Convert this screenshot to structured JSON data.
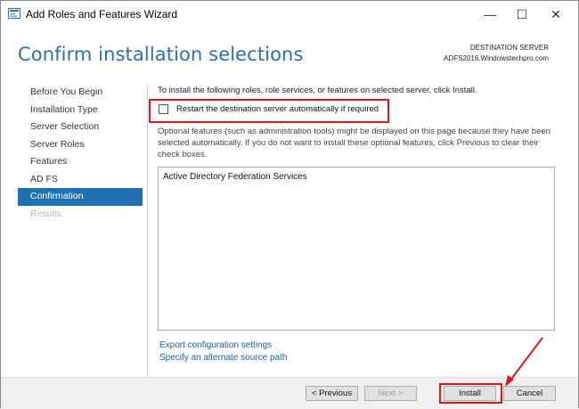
{
  "window": {
    "title": "Add Roles and Features Wizard",
    "minimize_glyph": "—",
    "maximize_glyph": "☐",
    "close_glyph": "✕"
  },
  "header": {
    "title": "Confirm installation selections",
    "destination_label": "DESTINATION SERVER",
    "destination_value": "ADFS2016.Windowstechpro.com"
  },
  "sidebar": {
    "items": [
      {
        "label": "Before You Begin",
        "state": "normal"
      },
      {
        "label": "Installation Type",
        "state": "normal"
      },
      {
        "label": "Server Selection",
        "state": "normal"
      },
      {
        "label": "Server Roles",
        "state": "normal"
      },
      {
        "label": "Features",
        "state": "normal"
      },
      {
        "label": "AD FS",
        "state": "normal"
      },
      {
        "label": "Confirmation",
        "state": "active"
      },
      {
        "label": "Results",
        "state": "disabled"
      }
    ]
  },
  "main": {
    "intro": "To install the following roles, role services, or features on selected server, click Install.",
    "restart_checkbox_label": "Restart the destination server automatically if required",
    "restart_checked": false,
    "optional_text": "Optional features (such as administration tools) might be displayed on this page because they have been selected automatically. If you do not want to install these optional features, click Previous to clear their check boxes.",
    "features_list": [
      "Active Directory Federation Services"
    ],
    "export_link": "Export configuration settings",
    "alternate_source_link": "Specify an alternate source path"
  },
  "footer": {
    "previous_label": "< Previous",
    "next_label": "Next >",
    "install_label": "Install",
    "cancel_label": "Cancel"
  },
  "colors": {
    "accent": "#1f6fb3",
    "title_blue": "#2b6fb0",
    "highlight_red": "#e0161b",
    "link_blue": "#1a5fa8"
  }
}
